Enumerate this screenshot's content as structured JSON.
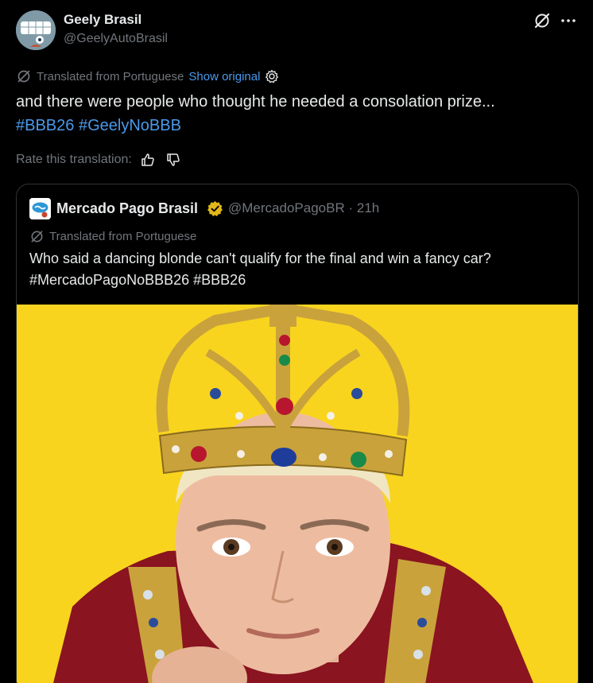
{
  "author": {
    "name": "Geely Brasil",
    "handle": "@GeelyAutoBrasil"
  },
  "icons": {
    "grok": "grok-icon",
    "more": "more-icon",
    "translate": "translate-icon",
    "settings": "gear-icon",
    "like": "thumbs-up-icon",
    "dislike": "thumbs-down-icon",
    "verified": "verified-badge-icon"
  },
  "translation": {
    "label": "Translated from Portuguese",
    "show_original": "Show original"
  },
  "tweet": {
    "text": "and there were people who thought he needed a consolation prize...",
    "hashtags": [
      "#BBB26",
      "#GeelyNoBBB"
    ]
  },
  "rate": {
    "label": "Rate this translation:"
  },
  "quote": {
    "name": "Mercado Pago Brasil",
    "handle": "@MercadoPagoBR",
    "separator": "·",
    "time": "21h",
    "translation_label": "Translated from Portuguese",
    "text": "Who said a dancing blonde can't qualify for the final and win a fancy car?",
    "hashtags": [
      "#MercadoPagoNoBBB26",
      "#BBB26"
    ]
  },
  "colors": {
    "background": "#000000",
    "text": "#e7e9ea",
    "muted": "#71767b",
    "link": "#4a99e9",
    "verified_gold": "#e2b719",
    "image_background": "#f8d41f"
  }
}
